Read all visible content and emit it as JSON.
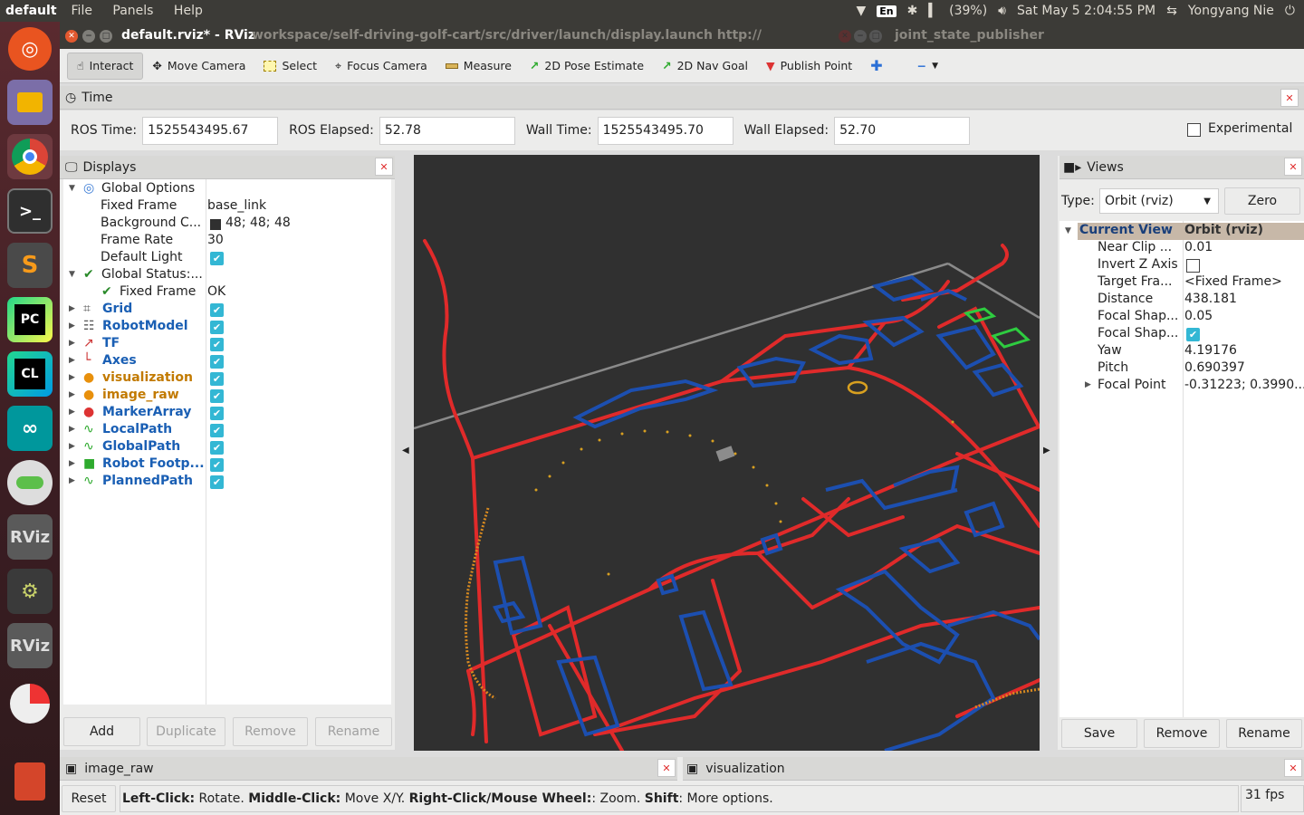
{
  "topbar": {
    "app_name": "default",
    "menus": [
      "File",
      "Panels",
      "Help"
    ],
    "keyboard": "En",
    "battery": "(39%)",
    "datetime": "Sat May  5  2:04:55 PM",
    "user": "Yongyang Nie"
  },
  "window": {
    "title": "default.rviz* - RViz",
    "path": "workspace/self-driving-golf-cart/src/driver/launch/display.launch http://",
    "second_window": "joint_state_publisher"
  },
  "toolbar": {
    "interact": "Interact",
    "move_camera": "Move Camera",
    "select": "Select",
    "focus_camera": "Focus Camera",
    "measure": "Measure",
    "pose_estimate": "2D Pose Estimate",
    "nav_goal": "2D Nav Goal",
    "publish_point": "Publish Point"
  },
  "time_panel": {
    "title": "Time",
    "ros_time_label": "ROS Time:",
    "ros_time": "1525543495.67",
    "ros_elapsed_label": "ROS Elapsed:",
    "ros_elapsed": "52.78",
    "wall_time_label": "Wall Time:",
    "wall_time": "1525543495.70",
    "wall_elapsed_label": "Wall Elapsed:",
    "wall_elapsed": "52.70",
    "experimental": "Experimental"
  },
  "displays": {
    "title": "Displays",
    "global_options": "Global Options",
    "fixed_frame_label": "Fixed Frame",
    "fixed_frame": "base_link",
    "background_label": "Background C...",
    "background": "48; 48; 48",
    "background_color": "#303030",
    "frame_rate_label": "Frame Rate",
    "frame_rate": "30",
    "default_light_label": "Default Light",
    "global_status": "Global Status:...",
    "fixed_frame_status_label": "Fixed Frame",
    "fixed_frame_status": "OK",
    "items": [
      {
        "name": "Grid",
        "color": "blue"
      },
      {
        "name": "RobotModel",
        "color": "blue"
      },
      {
        "name": "TF",
        "color": "blue"
      },
      {
        "name": "Axes",
        "color": "blue"
      },
      {
        "name": "visualization",
        "color": "orange"
      },
      {
        "name": "image_raw",
        "color": "orange"
      },
      {
        "name": "MarkerArray",
        "color": "blue"
      },
      {
        "name": "LocalPath",
        "color": "blue"
      },
      {
        "name": "GlobalPath",
        "color": "blue"
      },
      {
        "name": "Robot Footp...",
        "color": "blue"
      },
      {
        "name": "PlannedPath",
        "color": "blue"
      }
    ],
    "buttons": {
      "add": "Add",
      "duplicate": "Duplicate",
      "remove": "Remove",
      "rename": "Rename"
    }
  },
  "views": {
    "title": "Views",
    "type_label": "Type:",
    "type_value": "Orbit (rviz)",
    "zero": "Zero",
    "current_view": "Current View",
    "current_view_type": "Orbit (rviz)",
    "props": [
      {
        "label": "Near Clip ...",
        "value": "0.01"
      },
      {
        "label": "Invert Z Axis",
        "value": ""
      },
      {
        "label": "Target Fra...",
        "value": "<Fixed Frame>"
      },
      {
        "label": "Distance",
        "value": "438.181"
      },
      {
        "label": "Focal Shap...",
        "value": "0.05"
      },
      {
        "label": "Focal Shap...",
        "value": ""
      },
      {
        "label": "Yaw",
        "value": "4.19176"
      },
      {
        "label": "Pitch",
        "value": "0.690397"
      },
      {
        "label": "Focal Point",
        "value": "-0.31223; 0.3990..."
      }
    ],
    "buttons": {
      "save": "Save",
      "remove": "Remove",
      "rename": "Rename"
    }
  },
  "bottom": {
    "image_panel": "image_raw",
    "vis_panel": "visualization",
    "reset": "Reset",
    "help_lc": "Left-Click:",
    "help_lc_t": " Rotate. ",
    "help_mc": "Middle-Click:",
    "help_mc_t": " Move X/Y. ",
    "help_rc": "Right-Click/Mouse Wheel:",
    "help_rc_t": ": Zoom. ",
    "help_sh": "Shift",
    "help_sh_t": ": More options.",
    "fps": "31 fps"
  },
  "colors": {
    "road": "#e02a2a",
    "building": "#1c4fb0",
    "path": "#d8a020",
    "accent": "#33b7d4"
  }
}
